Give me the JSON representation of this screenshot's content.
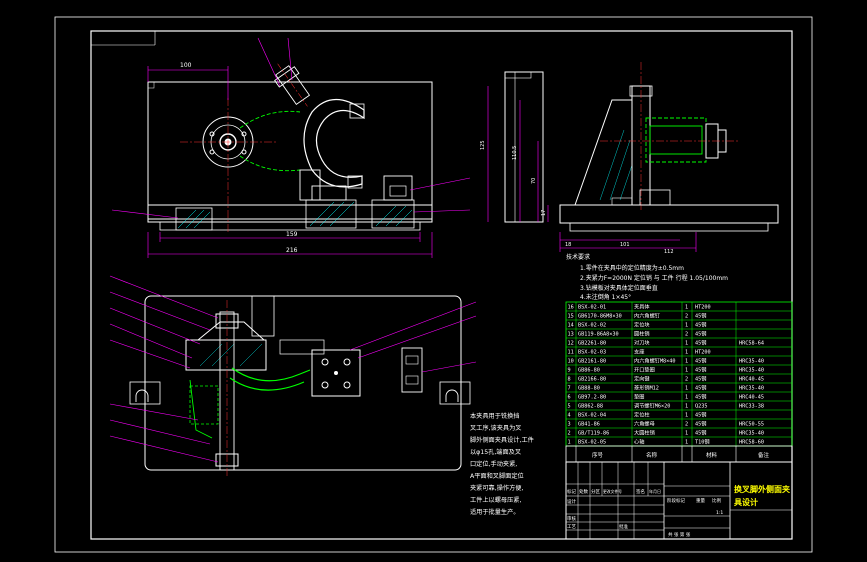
{
  "drawing": {
    "title_line1": "换叉脚外侧面夹",
    "title_line2": "具设计",
    "dimensions": {
      "front_width_top": "100",
      "front_overall_1": "159",
      "front_overall_2": "216",
      "side_h1": "125",
      "side_h2": "110.5",
      "side_h3": "70",
      "side_h4": "17",
      "side_w1": "18",
      "side_w2": "101",
      "side_w3": "112"
    },
    "tech_notes": [
      "1.零件在夹具中的定位精度为±0.5mm",
      "2.夹紧力F=2000N 定位销 与 工件 行程 1.05/100mm",
      "3.钻模板对夹具体定位面垂直",
      "4.未注倒角 1×45°"
    ],
    "description_lines": [
      "本夹具用于铣换挡",
      "叉工序,该夹具为叉",
      "脚外侧面夹具设计,工件",
      "以φ15孔,端面及叉",
      "口定位,手动夹紧,",
      "A平面和叉脚面定位",
      "夹紧可靠,操作方便,",
      "工件上以螺母压紧,",
      "适用于批量生产。"
    ],
    "bom": [
      {
        "no": "16",
        "code": "BSX-02-01",
        "name": "夹具体",
        "qty": "1",
        "mat": "HT200",
        "note": ""
      },
      {
        "no": "15",
        "code": "GB6170-86M8×30",
        "name": "内六角螺钉",
        "qty": "2",
        "mat": "45钢",
        "note": ""
      },
      {
        "no": "14",
        "code": "BSX-02-02",
        "name": "定位块",
        "qty": "1",
        "mat": "45钢",
        "note": ""
      },
      {
        "no": "13",
        "code": "GB119-86A8×30",
        "name": "圆柱销",
        "qty": "2",
        "mat": "45钢",
        "note": ""
      },
      {
        "no": "12",
        "code": "GB2261-80",
        "name": "对刀块",
        "qty": "1",
        "mat": "45钢",
        "note": "HRC58-64"
      },
      {
        "no": "11",
        "code": "BSX-02-03",
        "name": "支座",
        "qty": "1",
        "mat": "HT200",
        "note": ""
      },
      {
        "no": "10",
        "code": "GB2161-80",
        "name": "内六角螺钉M8×40",
        "qty": "1",
        "mat": "45钢",
        "note": "HRC35-40"
      },
      {
        "no": "9",
        "code": "GB86-80",
        "name": "开口垫圈",
        "qty": "1",
        "mat": "45钢",
        "note": "HRC35-40"
      },
      {
        "no": "8",
        "code": "GB2166-80",
        "name": "定向键",
        "qty": "2",
        "mat": "45钢",
        "note": "HRC40-45"
      },
      {
        "no": "7",
        "code": "GB88-80",
        "name": "菱形销M12",
        "qty": "1",
        "mat": "45钢",
        "note": "HRC35-40"
      },
      {
        "no": "6",
        "code": "GB97.2-80",
        "name": "垫圈",
        "qty": "1",
        "mat": "45钢",
        "note": "HRC40-45"
      },
      {
        "no": "5",
        "code": "GB862-88",
        "name": "调节螺钉M6×20",
        "qty": "1",
        "mat": "Q235",
        "note": "HRC33-38"
      },
      {
        "no": "4",
        "code": "BSX-02-04",
        "name": "定位柱",
        "qty": "1",
        "mat": "45钢",
        "note": ""
      },
      {
        "no": "3",
        "code": "GB41-86",
        "name": "六角螺母",
        "qty": "2",
        "mat": "45钢",
        "note": "HRC50-55"
      },
      {
        "no": "2",
        "code": "GB/T119-86",
        "name": "大圆柱销",
        "qty": "1",
        "mat": "45钢",
        "note": "HRC35-40"
      },
      {
        "no": "1",
        "code": "BSX-02-05",
        "name": "心轴",
        "qty": "1",
        "mat": "T10钢",
        "note": "HRC58-60"
      }
    ],
    "bom_header": {
      "no": "序号",
      "name": "名称",
      "mat": "材料",
      "note": "备注"
    },
    "title_block": {
      "row1": [
        "标记",
        "处数",
        "分区",
        "更改文件号",
        "签名",
        "年月日"
      ],
      "design": "设计",
      "check": "审核",
      "process": "工艺",
      "approve": "批准",
      "stage": "阶段标记",
      "weight": "重量",
      "scale": "比例",
      "scale_val": "1:1",
      "sheet": "共 张 第 张"
    }
  },
  "colors": {
    "bg": "#000000",
    "line": "#ffffff",
    "dim": "#ff00ff",
    "hidden": "#00ff00",
    "center": "#ff3030",
    "hatch": "#00ffff",
    "bom_green": "#00ff00",
    "title_yellow": "#ffff00",
    "leader": "#ff00ff"
  }
}
